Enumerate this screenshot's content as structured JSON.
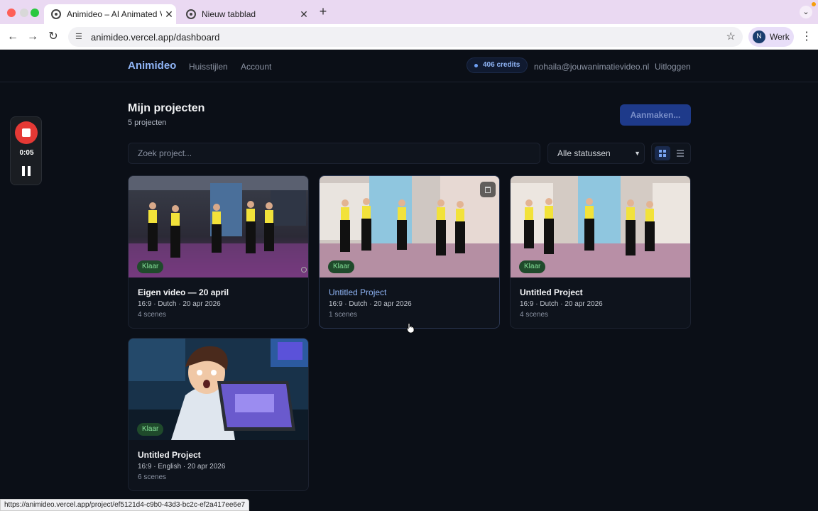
{
  "browser": {
    "tabs": [
      {
        "title": "Animideo – AI Animated Vide"
      },
      {
        "title": "Nieuw tabblad"
      }
    ],
    "url": "animideo.vercel.app/dashboard",
    "profile": {
      "initial": "N",
      "name": "Werk"
    },
    "status_url": "https://animideo.vercel.app/project/ef5121d4-c9b0-43d3-bc2c-ef2a417ee6e7"
  },
  "recorder": {
    "time": "0:05"
  },
  "app": {
    "brand": "Animideo",
    "nav": [
      "Huisstijlen",
      "Account"
    ],
    "credits": "406 credits",
    "email": "nohaila@jouwanimatievideo.nl",
    "logout": "Uitloggen"
  },
  "page": {
    "title": "Mijn projecten",
    "count": "5 projecten",
    "create_button": "Aanmaken...",
    "search_placeholder": "Zoek project...",
    "status_filter": "Alle statussen"
  },
  "projects": [
    {
      "status": "Klaar",
      "title": "Eigen video — 20 april",
      "meta": "16:9 · Dutch · 20 apr 2026",
      "scenes": "4 scenes",
      "thumb": "dancers"
    },
    {
      "status": "Klaar",
      "title": "Untitled Project",
      "meta": "16:9 · Dutch · 20 apr 2026",
      "scenes": "1 scenes",
      "thumb": "dancers-cartoon"
    },
    {
      "status": "Klaar",
      "title": "Untitled Project",
      "meta": "16:9 · Dutch · 20 apr 2026",
      "scenes": "4 scenes",
      "thumb": "dancers-cartoon"
    },
    {
      "status": "Klaar",
      "title": "Untitled Project",
      "meta": "16:9 · English · 20 apr 2026",
      "scenes": "6 scenes",
      "thumb": "laptop-cartoon"
    }
  ],
  "colors": {
    "accent": "#8fb4f5",
    "badge_bg": "#1f4a2b",
    "badge_text": "#86e29a",
    "create_bg": "#1e3a8a"
  }
}
